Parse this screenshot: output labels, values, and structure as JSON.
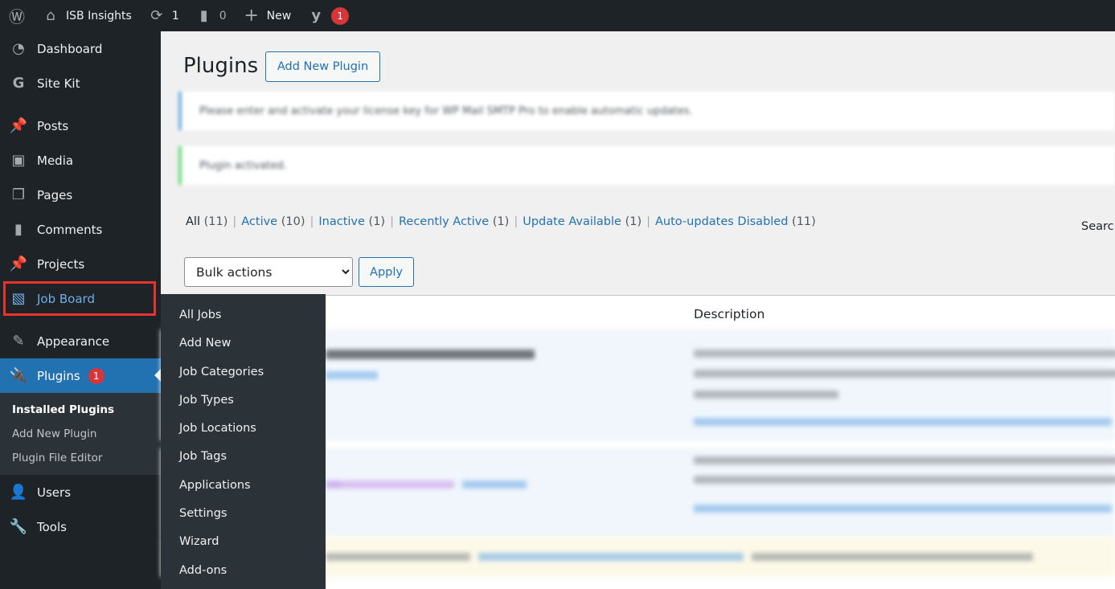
{
  "adminbar": {
    "site": "ISB Insights",
    "updates": "1",
    "comments": "0",
    "new": "New",
    "yoast_badge": "1"
  },
  "sidebar": {
    "items": [
      {
        "label": "Dashboard",
        "icon": "dashboard-icon"
      },
      {
        "label": "Site Kit",
        "icon": "google-icon"
      },
      {
        "label": "Posts",
        "icon": "pin-icon"
      },
      {
        "label": "Media",
        "icon": "media-icon"
      },
      {
        "label": "Pages",
        "icon": "pages-icon"
      },
      {
        "label": "Comments",
        "icon": "comment-icon"
      },
      {
        "label": "Projects",
        "icon": "pin-icon"
      },
      {
        "label": "Job Board",
        "icon": "clipboard-icon"
      },
      {
        "label": "Appearance",
        "icon": "brush-icon"
      },
      {
        "label": "Plugins",
        "icon": "plug-icon",
        "badge": "1"
      },
      {
        "label": "Users",
        "icon": "user-icon"
      },
      {
        "label": "Tools",
        "icon": "wrench-icon"
      }
    ],
    "plugins_sub": [
      "Installed Plugins",
      "Add New Plugin",
      "Plugin File Editor"
    ]
  },
  "flyout": [
    "All Jobs",
    "Add New",
    "Job Categories",
    "Job Types",
    "Job Locations",
    "Job Tags",
    "Applications",
    "Settings",
    "Wizard",
    "Add-ons"
  ],
  "main": {
    "title": "Plugins",
    "add_new": "Add New Plugin",
    "notice1": "Please enter and activate your license key for WP Mail SMTP Pro to enable automatic updates.",
    "notice2": "Plugin activated.",
    "filters": [
      {
        "label": "All",
        "count": "(11)"
      },
      {
        "label": "Active",
        "count": "(10)"
      },
      {
        "label": "Inactive",
        "count": "(1)"
      },
      {
        "label": "Recently Active",
        "count": "(1)"
      },
      {
        "label": "Update Available",
        "count": "(1)"
      },
      {
        "label": "Auto-updates Disabled",
        "count": "(11)"
      }
    ],
    "search": "Search",
    "bulk": "Bulk actions",
    "apply": "Apply",
    "col_description": "Description"
  },
  "colors": {
    "accent": "#2271b1",
    "sidebar": "#1d2327",
    "highlight": "#e8342b",
    "badge": "#d63638"
  }
}
